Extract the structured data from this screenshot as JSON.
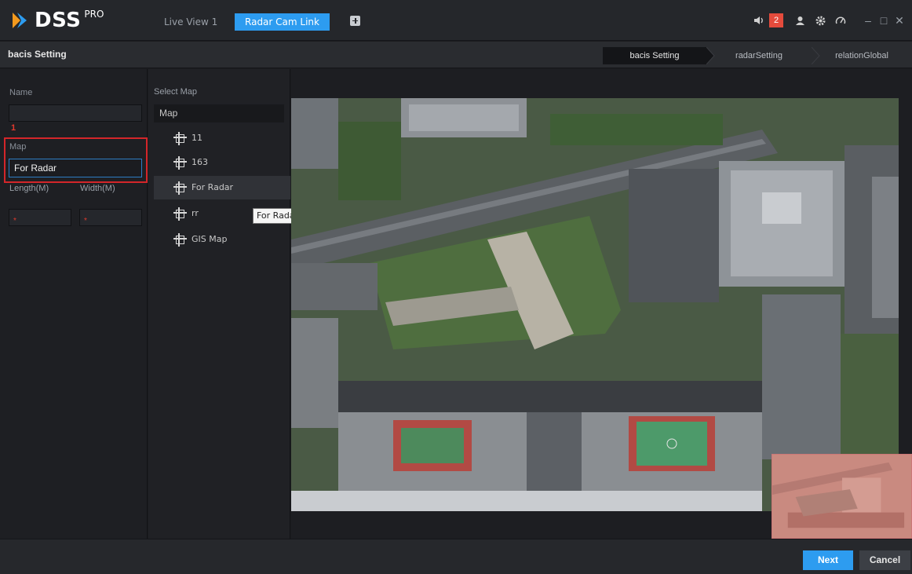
{
  "app": {
    "logo_text": "DSS",
    "logo_sup": "PRO",
    "tabs": [
      "Live View 1",
      "Radar Cam Link"
    ],
    "alarm_count": "2"
  },
  "header": {
    "title": "bacis Setting",
    "steps": [
      "bacis Setting",
      "radarSetting",
      "relationGlobal"
    ]
  },
  "form": {
    "name_label": "Name",
    "name_value": "",
    "annotation": "1",
    "map_label": "Map",
    "map_value": "For Radar",
    "length_label": "Length(M)",
    "width_label": "Width(M)",
    "required_mark": "*"
  },
  "select_map": {
    "title": "Select Map",
    "root": "Map",
    "items": [
      "11",
      "163",
      "For Radar",
      "rr",
      "GIS Map"
    ],
    "tooltip": "For Radar"
  },
  "footer": {
    "next_label": "Next",
    "cancel_label": "Cancel"
  },
  "colors": {
    "accent": "#2d9cf0",
    "highlight_box": "#d4262a",
    "badge": "#e54b3c"
  }
}
